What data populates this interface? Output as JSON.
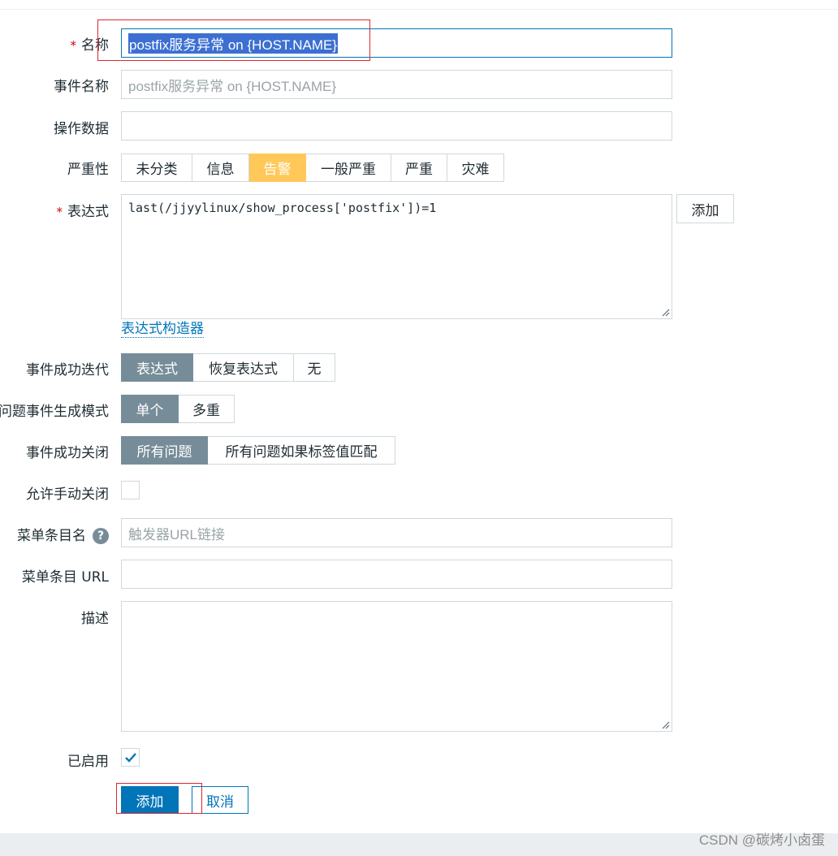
{
  "form": {
    "name": {
      "label": "名称",
      "value": "postfix服务异常 on {HOST.NAME}"
    },
    "event_name": {
      "label": "事件名称",
      "placeholder": "postfix服务异常 on {HOST.NAME}"
    },
    "opdata": {
      "label": "操作数据",
      "value": ""
    },
    "severity": {
      "label": "严重性",
      "options": [
        "未分类",
        "信息",
        "告警",
        "一般严重",
        "严重",
        "灾难"
      ],
      "selected": "告警"
    },
    "expression": {
      "label": "表达式",
      "value": "last(/jjyylinux/show_process['postfix'])=1",
      "add_label": "添加",
      "builder_link": "表达式构造器"
    },
    "ok_event_gen": {
      "label": "事件成功迭代",
      "options": [
        "表达式",
        "恢复表达式",
        "无"
      ],
      "selected": "表达式"
    },
    "problem_mode": {
      "label": "问题事件生成模式",
      "options": [
        "单个",
        "多重"
      ],
      "selected": "单个"
    },
    "ok_close": {
      "label": "事件成功关闭",
      "options": [
        "所有问题",
        "所有问题如果标签值匹配"
      ],
      "selected": "所有问题"
    },
    "manual_close": {
      "label": "允许手动关闭",
      "checked": false
    },
    "url_name": {
      "label": "菜单条目名",
      "help": "?",
      "placeholder": "触发器URL链接"
    },
    "url": {
      "label": "菜单条目 URL",
      "value": ""
    },
    "description": {
      "label": "描述",
      "value": ""
    },
    "enabled": {
      "label": "已启用",
      "checked": true
    },
    "required_mark": "*",
    "buttons": {
      "add": "添加",
      "cancel": "取消"
    }
  },
  "watermark": "CSDN @碳烤小卤蛋",
  "colors": {
    "primary": "#0275b8",
    "warning": "#ffc859",
    "selected_grey": "#768d99",
    "highlight_box": "#d8282e"
  }
}
